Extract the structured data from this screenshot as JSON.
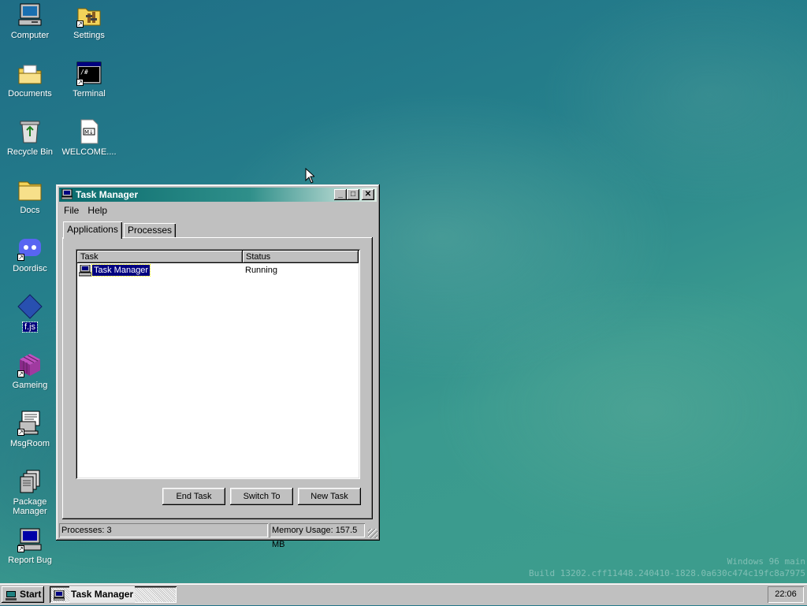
{
  "desktop": {
    "icons": [
      {
        "label": "Computer",
        "icon": "computer-icon"
      },
      {
        "label": "Settings",
        "icon": "settings-icon"
      },
      {
        "label": "Documents",
        "icon": "documents-folder-icon"
      },
      {
        "label": "Terminal",
        "icon": "terminal-icon"
      },
      {
        "label": "Recycle Bin",
        "icon": "recycle-bin-icon"
      },
      {
        "label": "WELCOME....",
        "icon": "markdown-file-icon"
      },
      {
        "label": "Docs",
        "icon": "folder-icon"
      },
      {
        "label": "Doordisc",
        "icon": "doordisc-icon"
      },
      {
        "label": "f.js",
        "icon": "js-file-icon"
      },
      {
        "label": "Gameing",
        "icon": "games-cube-icon"
      },
      {
        "label": "MsgRoom",
        "icon": "msgroom-icon"
      },
      {
        "label": "Package Manager",
        "icon": "package-manager-icon"
      },
      {
        "label": "Report Bug",
        "icon": "report-bug-icon"
      }
    ],
    "watermark": {
      "line1": "Windows 96 main",
      "line2": "Build 13202.cff11448.240410-1828.0a630c474c19fc8a7975"
    }
  },
  "window": {
    "title": "Task Manager",
    "menu": [
      "File",
      "Help"
    ],
    "tabs": [
      {
        "label": "Applications",
        "active": true
      },
      {
        "label": "Processes",
        "active": false
      }
    ],
    "columns": [
      "Task",
      "Status"
    ],
    "rows": [
      {
        "task": "Task Manager",
        "status": "Running",
        "selected": true
      }
    ],
    "buttons": {
      "end_task": "End Task",
      "switch_to": "Switch To",
      "new_task": "New Task"
    },
    "status": {
      "processes": "Processes: 3",
      "memory": "Memory Usage: 157.5 MB"
    }
  },
  "taskbar": {
    "start_label": "Start",
    "items": [
      {
        "label": "Task Manager"
      }
    ],
    "clock": "22:06"
  },
  "colors": {
    "desktop": "#2a8a8a",
    "title_bar": "#0a6b6e",
    "selection": "#000080",
    "face": "#c0c0c0"
  }
}
